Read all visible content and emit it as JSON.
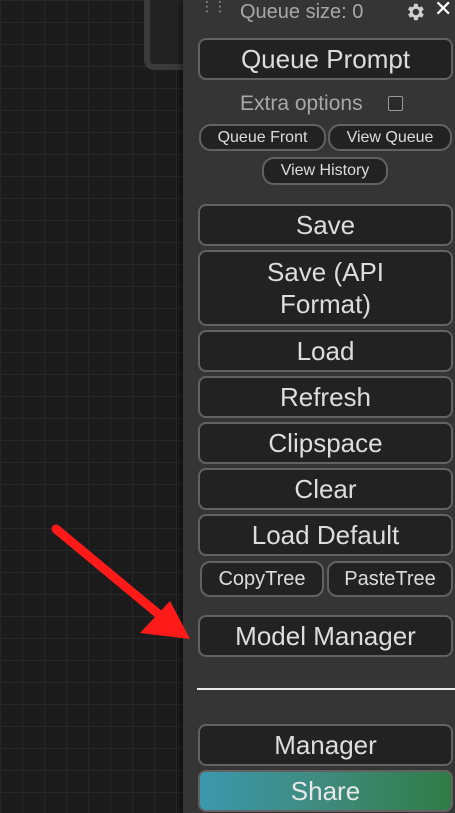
{
  "queue": {
    "size_label": "Queue size: 0",
    "prompt_button": "Queue Prompt",
    "extra_options_label": "Extra options",
    "extra_options_checked": false,
    "front_button": "Queue Front",
    "view_queue_button": "View Queue",
    "view_history_button": "View History"
  },
  "menu": {
    "save": "Save",
    "save_api": "Save (API Format)",
    "load": "Load",
    "refresh": "Refresh",
    "clipspace": "Clipspace",
    "clear": "Clear",
    "load_default": "Load Default",
    "copy_tree": "CopyTree",
    "paste_tree": "PasteTree",
    "model_manager": "Model Manager",
    "manager": "Manager",
    "share": "Share"
  },
  "icons": {
    "drag": "drag-handle-icon",
    "settings": "gear-icon",
    "close": "close-icon",
    "annotation": "red-arrow-icon"
  },
  "colors": {
    "panel_bg": "#353535",
    "button_bg": "#222222",
    "button_border": "#626262",
    "arrow": "#ff1a1a",
    "share_gradient_start": "#3b98ae",
    "share_gradient_end": "#2f7c46"
  }
}
